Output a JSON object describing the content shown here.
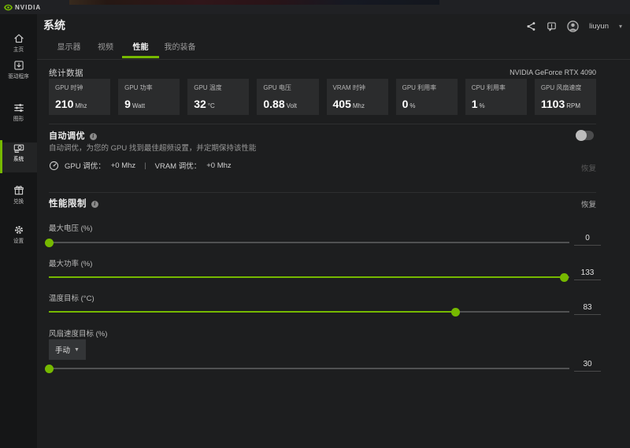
{
  "titlebar": {
    "brand": "NVIDIA"
  },
  "sidebar": {
    "items": [
      {
        "label": "主页"
      },
      {
        "label": "驱动程序"
      },
      {
        "label": "图形"
      },
      {
        "label": "系统"
      },
      {
        "label": "兑换"
      },
      {
        "label": "设置"
      }
    ]
  },
  "header": {
    "title": "系统",
    "username": "liuyun"
  },
  "tabs": {
    "items": [
      {
        "label": "显示器"
      },
      {
        "label": "视频"
      },
      {
        "label": "性能"
      },
      {
        "label": "我的装备"
      }
    ],
    "active": "性能"
  },
  "stats": {
    "section_title": "统计数据",
    "gpu_name": "NVIDIA GeForce RTX 4090",
    "cards": [
      {
        "label": "GPU 时钟",
        "value": "210",
        "unit": "Mhz"
      },
      {
        "label": "GPU 功率",
        "value": "9",
        "unit": "Watt"
      },
      {
        "label": "GPU 温度",
        "value": "32",
        "unit": "°C"
      },
      {
        "label": "GPU 电压",
        "value": "0.88",
        "unit": "Volt"
      },
      {
        "label": "VRAM 时钟",
        "value": "405",
        "unit": "Mhz"
      },
      {
        "label": "GPU 利用率",
        "value": "0",
        "unit": "%"
      },
      {
        "label": "CPU 利用率",
        "value": "1",
        "unit": "%"
      },
      {
        "label": "GPU 风扇速度",
        "value": "1103",
        "unit": "RPM"
      }
    ]
  },
  "auto_tune": {
    "title": "自动调优",
    "description": "自动调优，为您的 GPU 找到最佳超频设置，并定期保持该性能",
    "gpu_tune_label": "GPU 调优：",
    "gpu_tune_value": "+0 Mhz",
    "separator": "|",
    "vram_tune_label": "VRAM 调优：",
    "vram_tune_value": "+0 Mhz",
    "restore_label": "恢复",
    "toggle_state": "off"
  },
  "perf_limits": {
    "title": "性能限制",
    "restore_label": "恢复",
    "sliders": [
      {
        "label": "最大电压 (%)",
        "value": "0",
        "fill_pct": 0
      },
      {
        "label": "最大功率 (%)",
        "value": "133",
        "fill_pct": 99
      },
      {
        "label": "温度目标 (°C)",
        "value": "83",
        "fill_pct": 78
      },
      {
        "label": "风扇速度目标 (%)",
        "value": "30",
        "fill_pct": 0,
        "mode": "手动"
      }
    ]
  },
  "colors": {
    "accent": "#76b900"
  }
}
